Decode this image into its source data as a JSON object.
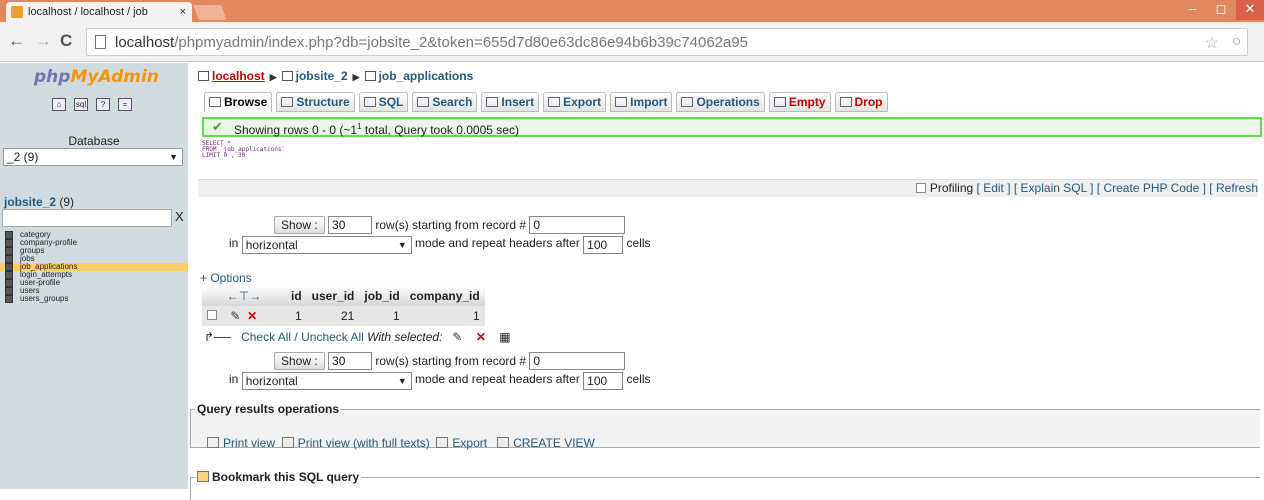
{
  "browser": {
    "tab_title": "localhost / localhost / job",
    "tab_close": "×",
    "url_host": "localhost",
    "url_path": "/phpmyadmin/index.php?db=jobsite_2&token=655d7d80e63dc86e94b6b39c74062a95"
  },
  "sidebar": {
    "logo_php": "php",
    "logo_myadmin": "MyAdmin",
    "database_label": "Database",
    "db_select_value": "_2 (9)",
    "current_db": "jobsite_2",
    "current_db_count": "(9)",
    "filter_clear": "X",
    "tables": [
      "category",
      "company-profile",
      "groups",
      "jobs",
      "job_applications",
      "login_attempts",
      "user-profile",
      "users",
      "users_groups"
    ],
    "active_table": "job_applications"
  },
  "breadcrumb": {
    "server": "localhost",
    "database": "jobsite_2",
    "table": "job_applications"
  },
  "tabs": [
    "Browse",
    "Structure",
    "SQL",
    "Search",
    "Insert",
    "Export",
    "Import",
    "Operations",
    "Empty",
    "Drop"
  ],
  "success_message": "Showing rows 0 - 0 (~1",
  "success_sup": "1",
  "success_tail": " total, Query took 0.0005 sec)",
  "sql_query": "SELECT *\nFROM `job_applications`\nLIMIT 0 , 30",
  "profiling": {
    "label": "Profiling",
    "links": "[ Edit ] [ Explain SQL ] [ Create PHP Code ] [ Refresh"
  },
  "nav_top": {
    "show_button": "Show :",
    "rows": "30",
    "starting_label": "row(s) starting from record #",
    "start_record": "0",
    "in_label": "in",
    "mode": "horizontal",
    "mode_label": "mode and repeat headers after",
    "repeat": "100",
    "cells_label": "cells"
  },
  "options_link": "+ Options",
  "results": {
    "columns": [
      "id",
      "user_id",
      "job_id",
      "company_id"
    ],
    "rows": [
      [
        "1",
        "21",
        "1",
        "1"
      ]
    ]
  },
  "with_selected": {
    "check_all": "Check All / Uncheck All",
    "label": "With selected:"
  },
  "query_ops": {
    "legend": "Query results operations",
    "print_view": "Print view",
    "print_full": "Print view (with full texts)",
    "export": "Export",
    "create_view": "CREATE VIEW"
  },
  "bookmark_legend": "Bookmark this SQL query"
}
